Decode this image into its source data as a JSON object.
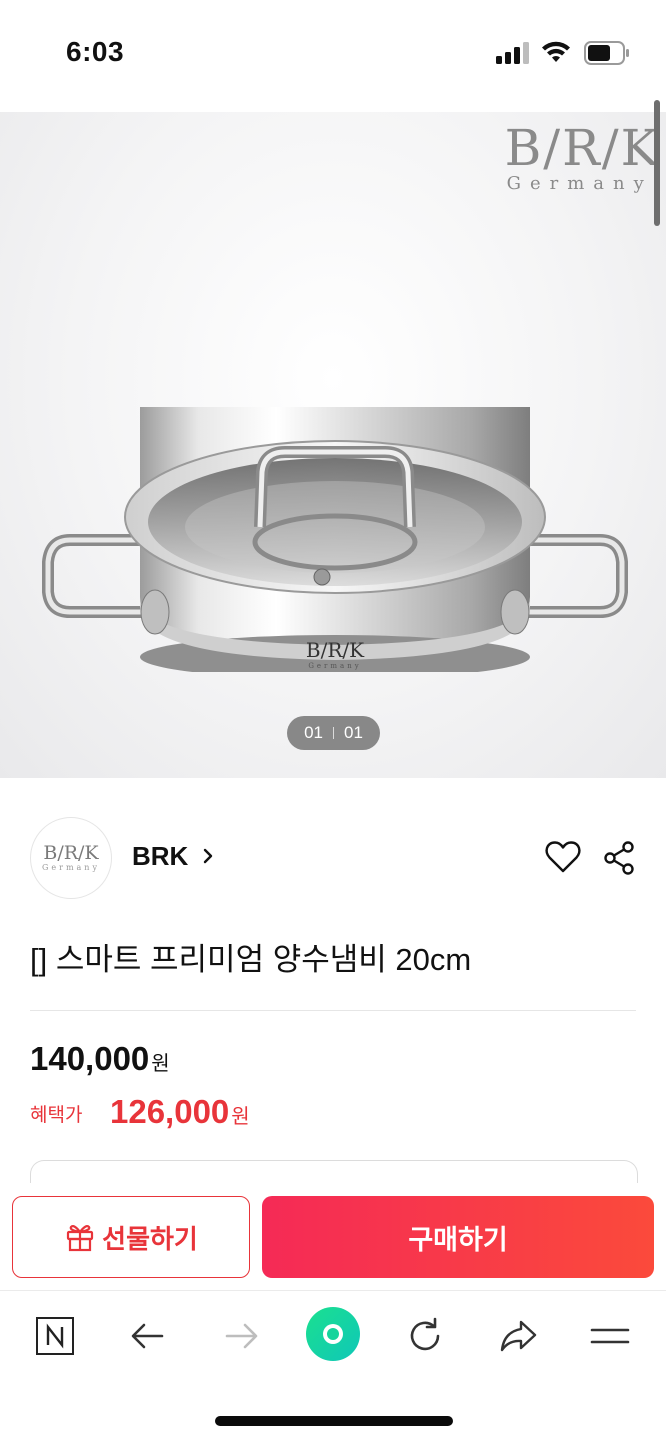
{
  "status_bar": {
    "time": "6:03"
  },
  "hero": {
    "brand_mark_main": "B/R/K",
    "brand_mark_sub": "Germany",
    "pot_engraving_main": "B/R/K",
    "pot_engraving_sub": "Germany",
    "pager_current": "01",
    "pager_total": "01"
  },
  "brand": {
    "logo_main": "B/R/K",
    "logo_sub": "Germany",
    "name": "BRK"
  },
  "product": {
    "title": "[] 스마트 프리미엄 양수냄비 20cm",
    "original_price": "140,000",
    "currency": "원",
    "benefit_label": "혜택가",
    "sale_price": "126,000"
  },
  "actions": {
    "gift_label": "선물하기",
    "buy_label": "구매하기"
  },
  "colors": {
    "accent_red": "#e8343a",
    "buy_gradient_start": "#f52a56",
    "buy_gradient_end": "#fb4a3b",
    "green_home": "#1fd9a0"
  },
  "browser_nav": {
    "icons": [
      "naver-n-icon",
      "back-arrow-icon",
      "forward-arrow-icon",
      "green-home-icon",
      "refresh-icon",
      "share-arrow-icon",
      "menu-icon"
    ]
  }
}
